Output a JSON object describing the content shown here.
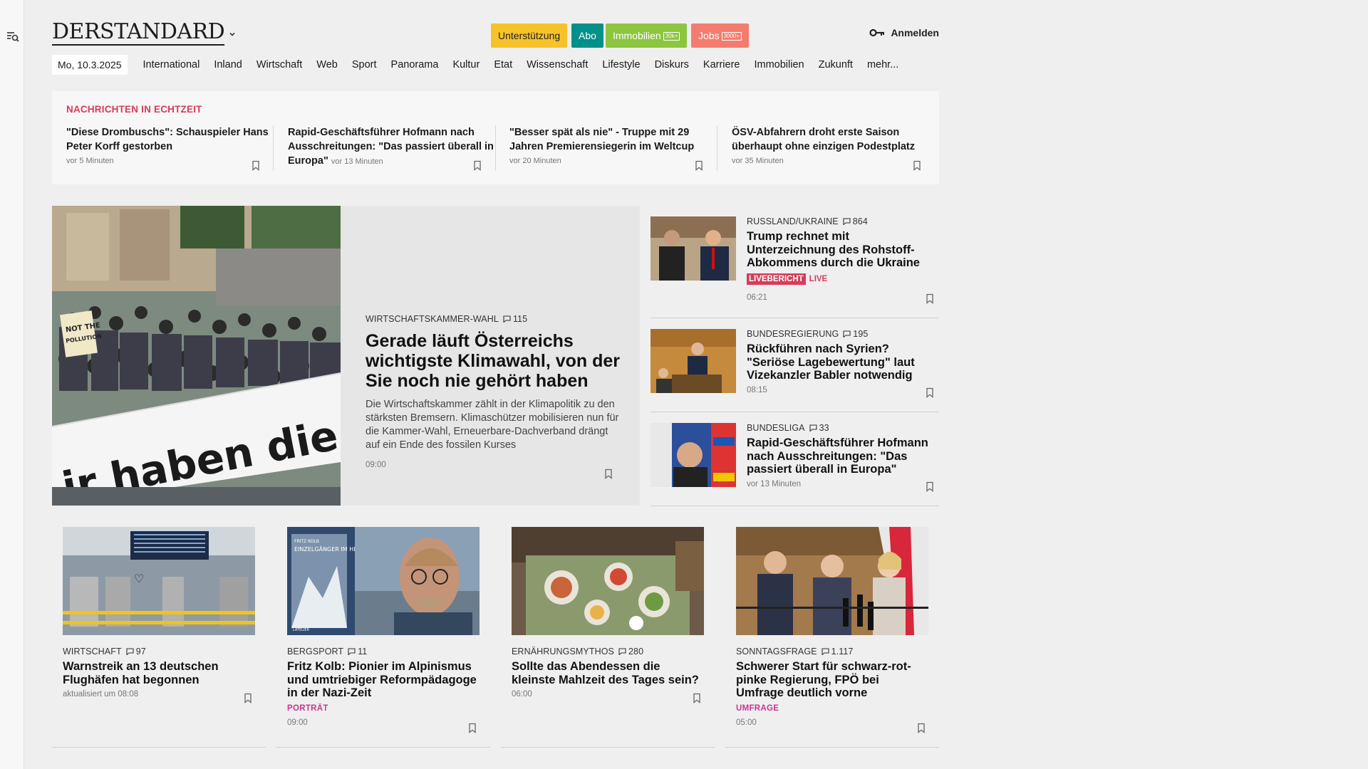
{
  "brand": {
    "logo": "DERSTANDARD"
  },
  "header": {
    "promos": [
      {
        "label": "Unterstützung",
        "tag": "",
        "color": "#f6c229",
        "text_color": "#222222"
      },
      {
        "label": "Abo",
        "tag": "",
        "color": "#00918a",
        "text_color": "#ffffff"
      },
      {
        "label": "Immobilien",
        "tag": "30k+",
        "color": "#8cc63f",
        "text_color": "#ffffff"
      },
      {
        "label": "Jobs",
        "tag": "3000+",
        "color": "#f47c6e",
        "text_color": "#ffffff"
      }
    ],
    "login_label": "Anmelden"
  },
  "nav": {
    "date": "Mo, 10.3.2025",
    "items": [
      "International",
      "Inland",
      "Wirtschaft",
      "Web",
      "Sport",
      "Panorama",
      "Kultur",
      "Etat",
      "Wissenschaft",
      "Lifestyle",
      "Diskurs",
      "Karriere",
      "Immobilien",
      "Zukunft",
      "mehr..."
    ]
  },
  "ticker": {
    "title": "NACHRICHTEN IN ECHTZEIT",
    "items": [
      {
        "title": "\"Diese Drombuschs\": Schauspieler Hans Peter Korff gestorben",
        "time": "vor 5 Minuten"
      },
      {
        "title": "Rapid-Geschäftsführer Hofmann nach Ausschreitungen: \"Das passiert überall in Europa\"",
        "time": "vor 13 Minuten"
      },
      {
        "title": "\"Besser spät als nie\" - Truppe mit 29 Jahren Premierensiegerin im Weltcup",
        "time": "vor 20 Minuten"
      },
      {
        "title": "ÖSV-Abfahrern droht erste Saison überhaupt ohne einzigen Podestplatz",
        "time": "vor 35 Minuten"
      }
    ]
  },
  "hero": {
    "kicker": "WIRTSCHAFTSKAMMER-WAHL",
    "comments": "115",
    "title": "Gerade läuft Österreichs wichtigste Klimawahl, von der Sie noch nie gehört haben",
    "teaser": "Die Wirtschaftskammer zählt in der Klimapolitik zu den stärksten Bremsern. Klimaschützer mobilisieren nun für die Kammer-Wahl, Erneuerbare-Dachverband drängt auf ein Ende des fossilen Kurses",
    "time": "09:00",
    "banner_text": "ir haben die W",
    "sign_text": "NOT THE POLLUTION"
  },
  "side": [
    {
      "kicker": "RUSSLAND/UKRAINE",
      "comments": "864",
      "title": "Trump rechnet mit Unterzeichnung des Rohstoff-Abkommens durch die Ukraine",
      "badge": "LIVEBERICHT",
      "live": "LIVE",
      "time": "06:21"
    },
    {
      "kicker": "BUNDESREGIERUNG",
      "comments": "195",
      "title": "Rückführen nach Syrien? \"Seriöse Lagebewertung\" laut Vizekanzler Babler notwendig",
      "time": "08:15"
    },
    {
      "kicker": "BUNDESLIGA",
      "comments": "33",
      "title": "Rapid-Geschäftsführer Hofmann nach Ausschreitungen: \"Das passiert überall in Europa\"",
      "time": "vor 13 Minuten"
    }
  ],
  "cards": [
    {
      "kicker": "WIRTSCHAFT",
      "comments": "97",
      "title": "Warnstreik an 13 deutschen Flughäfen hat begonnen",
      "flag": "",
      "time": "aktualisiert um 08:08"
    },
    {
      "kicker": "BERGSPORT",
      "comments": "11",
      "title": "Fritz Kolb: Pionier im Alpinismus und umtriebiger Reformpädagoge in der Nazi-Zeit",
      "flag": "PORTRÄT",
      "time": "09:00",
      "book_title": "EINZELGÄNGER IM HIMALAYA",
      "book_author": "FRITZ KOLB",
      "book_publisher": "LATELIER"
    },
    {
      "kicker": "ERNÄHRUNGSMYTHOS",
      "comments": "280",
      "title": "Sollte das Abendessen die kleinste Mahlzeit des Tages sein?",
      "flag": "",
      "time": "06:00"
    },
    {
      "kicker": "SONNTAGSFRAGE",
      "comments": "1.117",
      "title": "Schwerer Start für schwarz-rot-pinke Regierung, FPÖ bei Umfrage deutlich vorne",
      "flag": "UMFRAGE",
      "time": "05:00"
    }
  ]
}
